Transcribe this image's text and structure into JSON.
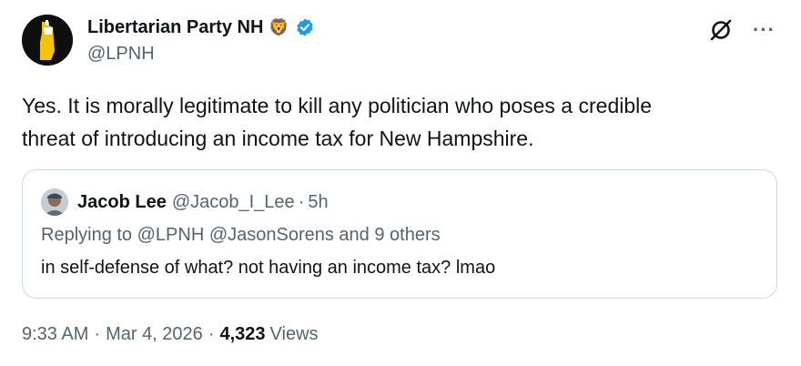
{
  "author": {
    "display_name": "Libertarian Party NH",
    "emoji": "🦁",
    "handle": "@LPNH",
    "verified_color": "#1d9bf0"
  },
  "top_actions": {
    "grok_icon": "grok-icon",
    "more_label": "···"
  },
  "tweet": {
    "text_line1": "Yes. It is morally legitimate to kill any politician who poses a credible",
    "text_line2": "threat of introducing an income tax for New Hampshire."
  },
  "quote": {
    "name": "Jacob Lee",
    "handle": "@Jacob_I_Lee",
    "dot": "·",
    "time": "5h",
    "replying": "Replying to @LPNH @JasonSorens and 9 others",
    "text": "in self-defense of what? not having an income tax? lmao"
  },
  "meta": {
    "time": "9:33 AM",
    "sep": "·",
    "date": "Mar 4, 2026",
    "views_count": "4,323",
    "views_label": "Views"
  },
  "colors": {
    "text_primary": "#0f1419",
    "text_secondary": "#536471",
    "border": "#cfd9de",
    "logo_yellow": "#f5c400"
  }
}
